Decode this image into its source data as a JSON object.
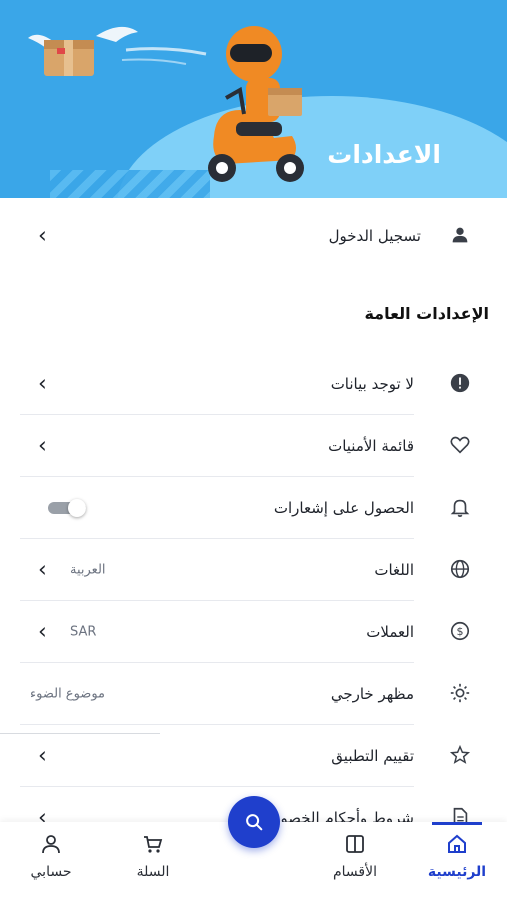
{
  "header": {
    "title": "الاعدادات"
  },
  "login": {
    "label": "تسجيل الدخول"
  },
  "general_section": {
    "title": "الإعدادات العامة"
  },
  "menu": {
    "no_data": {
      "label": "لا توجد بيانات"
    },
    "wishlist": {
      "label": "قائمة الأمنيات"
    },
    "notifications": {
      "label": "الحصول على إشعارات",
      "enabled": false
    },
    "languages": {
      "label": "اللغات",
      "value": "العربية"
    },
    "currencies": {
      "label": "العملات",
      "value": "SAR"
    },
    "appearance": {
      "label": "مظهر خارجي",
      "value": "موضوع الضوء"
    },
    "rate_app": {
      "label": "تقييم التطبيق"
    },
    "terms": {
      "label": "شروط وأحكام الخصوصية"
    }
  },
  "bottom_nav": {
    "home": "الرئيسية",
    "categories": "الأقسام",
    "cart": "السلة",
    "account": "حسابي"
  },
  "colors": {
    "accent": "#1f3fcc",
    "header_bg": "#3aa6e8"
  }
}
